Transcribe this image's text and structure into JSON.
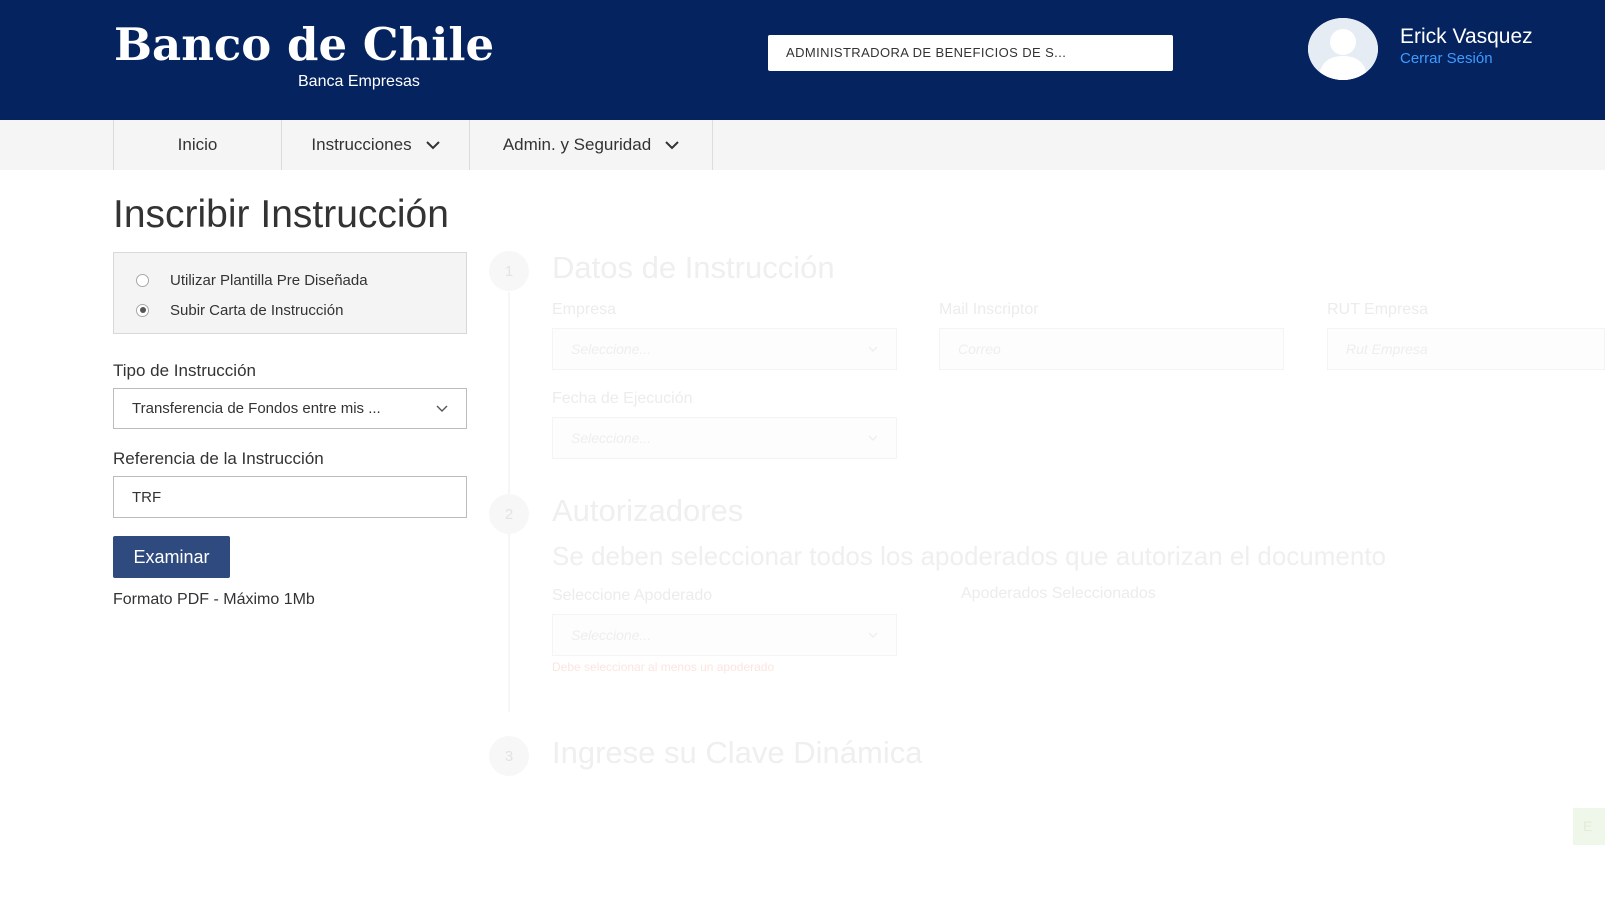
{
  "header": {
    "logo_text": "Banco de Chile",
    "logo_subtitle": "Banca Empresas",
    "company_selector": "ADMINISTRADORA DE BENEFICIOS DE S...",
    "user_name": "Erick Vasquez",
    "logout_label": "Cerrar Sesión",
    "background_color": "#04235f"
  },
  "nav": {
    "items": [
      {
        "label": "Inicio",
        "has_dropdown": false
      },
      {
        "label": "Instrucciones",
        "has_dropdown": true
      },
      {
        "label": "Admin. y Seguridad",
        "has_dropdown": true
      }
    ]
  },
  "page": {
    "title": "Inscribir Instrucción"
  },
  "mode_options": [
    {
      "label": "Utilizar Plantilla Pre Diseñada",
      "checked": false
    },
    {
      "label": "Subir Carta de Instrucción",
      "checked": true
    }
  ],
  "form": {
    "tipo_label": "Tipo de Instrucción",
    "tipo_value": "Transferencia de Fondos entre mis ...",
    "referencia_label": "Referencia de la Instrucción",
    "referencia_value": "TRF",
    "examinar_label": "Examinar",
    "format_hint": "Formato PDF - Máximo 1Mb",
    "button_color": "#2e4a7e"
  },
  "steps": {
    "step1": {
      "number": "1",
      "title": "Datos de Instrucción",
      "empresa_label": "Empresa",
      "empresa_placeholder": "Seleccione...",
      "mail_label": "Mail Inscriptor",
      "mail_placeholder": "Correo",
      "rut_label": "RUT Empresa",
      "rut_placeholder": "Rut Empresa",
      "fecha_label": "Fecha de Ejecución",
      "fecha_placeholder": "Seleccione..."
    },
    "step2": {
      "number": "2",
      "title": "Autorizadores",
      "subtitle": "Se deben seleccionar todos los apoderados que autorizan el documento",
      "apoderado_label": "Seleccione Apoderado",
      "apoderado_placeholder": "Seleccione...",
      "selected_label": "Apoderados Seleccionados",
      "error_text": "Debe seleccionar al menos un apoderado"
    },
    "step3": {
      "number": "3",
      "title": "Ingrese su Clave Dinámica"
    }
  },
  "corner_button_label": "E"
}
